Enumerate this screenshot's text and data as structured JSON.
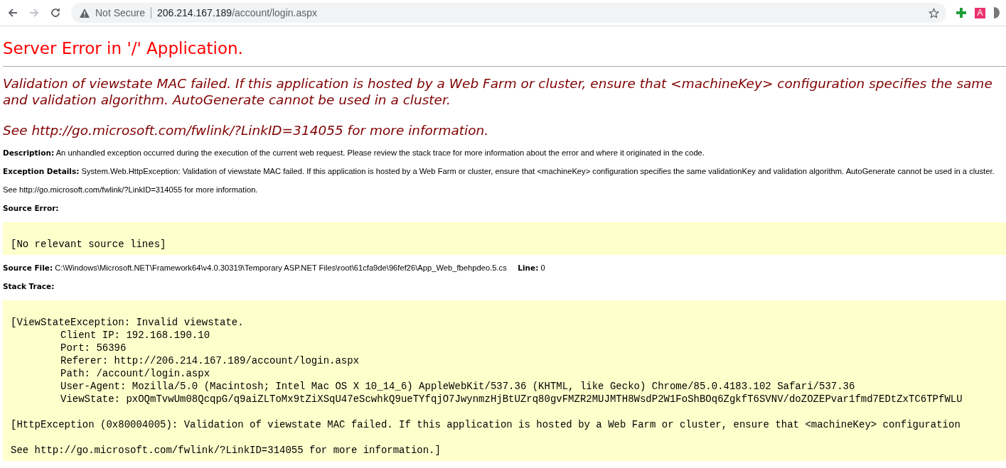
{
  "browser": {
    "security": "Not Secure",
    "url_host": "206.214.167.189",
    "url_path": "/account/login.aspx",
    "extensions": [
      {
        "kind": "plus"
      },
      {
        "kind": "letter",
        "label": "A"
      },
      {
        "kind": "partial"
      }
    ]
  },
  "page": {
    "title": "Server Error in '/' Application.",
    "heading_lines": [
      "Validation of viewstate MAC failed. If this application is hosted by a Web Farm or cluster, ensure that <machineKey> configuration specifies the same",
      "and validation algorithm. AutoGenerate cannot be used in a cluster."
    ],
    "heading_link": "See http://go.microsoft.com/fwlink/?LinkID=314055 for more information.",
    "description": {
      "label": "Description:",
      "text": "An unhandled exception occurred during the execution of the current web request. Please review the stack trace for more information about the error and where it originated in the code."
    },
    "exception_details": {
      "label": "Exception Details:",
      "text": "System.Web.HttpException: Validation of viewstate MAC failed. If this application is hosted by a Web Farm or cluster, ensure that <machineKey> configuration specifies the same validationKey and validation algorithm. AutoGenerate cannot be used in a cluster."
    },
    "see_more": "See http://go.microsoft.com/fwlink/?LinkID=314055 for more information.",
    "source_error": {
      "label": "Source Error:",
      "code": "[No relevant source lines]"
    },
    "source_file": {
      "label": "Source File:",
      "path": "C:\\Windows\\Microsoft.NET\\Framework64\\v4.0.30319\\Temporary ASP.NET Files\\root\\61cfa9de\\96fef26\\App_Web_fbehpdeo.5.cs",
      "line_label": "Line:",
      "line": "0"
    },
    "stack_trace": {
      "label": "Stack Trace:",
      "groups": [
        {
          "header": "[ViewStateException: Invalid viewstate.",
          "details": [
            "Client IP: 192.168.190.10",
            "Port: 56396",
            "Referer: http://206.214.167.189/account/login.aspx",
            "Path: /account/login.aspx",
            "User-Agent: Mozilla/5.0 (Macintosh; Intel Mac OS X 10_14_6) AppleWebKit/537.36 (KHTML, like Gecko) Chrome/85.0.4183.102 Safari/537.36",
            "ViewState: pxOQmTvwUm08QcqpG/q9aiZLToMx9tZiXSqU47eScwhkQ9ueTYfqjO7JwynmzHjBtUZrq80gvFMZR2MUJMTH8WsdP2W1FoShBOq6ZgkfT6SVNV/doZOZEPvar1fmd7EDtZxTC6TPfWLU"
          ]
        },
        {
          "header": "[HttpException (0x80004005): Validation of viewstate MAC failed. If this application is hosted by a Web Farm or cluster, ensure that <machineKey> configuration"
        },
        {
          "header": "See http://go.microsoft.com/fwlink/?LinkID=314055 for more information.]"
        }
      ]
    }
  }
}
